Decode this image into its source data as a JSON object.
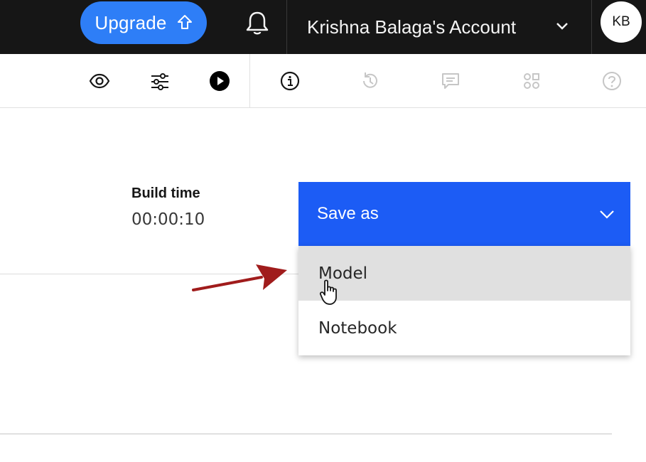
{
  "header": {
    "upgrade_label": "Upgrade",
    "account_name": "Krishna Balaga's Account",
    "avatar_initials": "KB",
    "icons": [
      "arrow-up-icon",
      "bell-icon",
      "chevron-down-icon"
    ]
  },
  "toolbar": {
    "icons": [
      "eye-icon",
      "sliders-icon",
      "play-icon",
      "info-icon",
      "history-icon",
      "comment-icon",
      "shapes-icon",
      "help-icon"
    ]
  },
  "build": {
    "label": "Build time",
    "value": "00:00:10"
  },
  "dropdown": {
    "label": "Save as",
    "options": [
      "Model",
      "Notebook"
    ],
    "hovered": "Model"
  },
  "colors": {
    "header_bg": "#161616",
    "upgrade_bg": "#2e7ef7",
    "dropdown_bg": "#1c5cf5",
    "hover_bg": "#e0e0e0",
    "annotation_arrow": "#a01c1c"
  }
}
